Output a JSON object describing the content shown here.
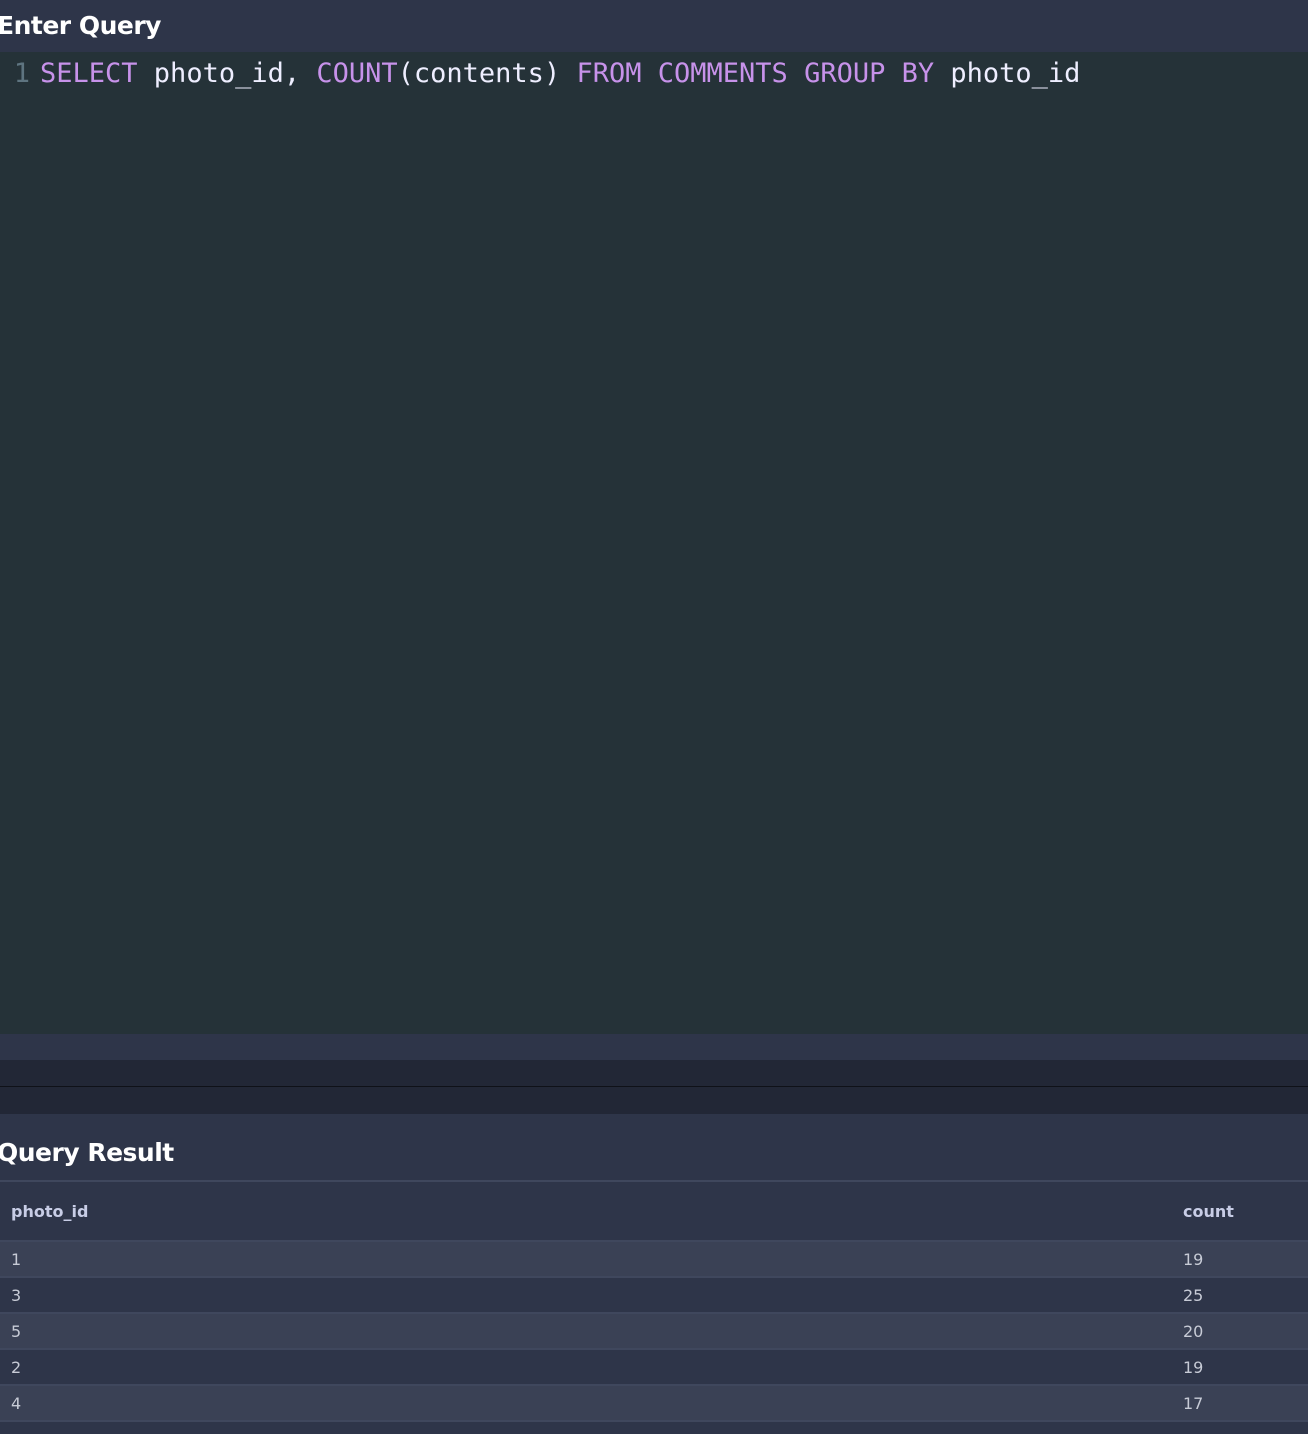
{
  "editor": {
    "title": "Enter Query",
    "line_number": "1",
    "tokens": [
      {
        "t": "SELECT",
        "k": "kw"
      },
      {
        "t": " photo_id, ",
        "k": "id"
      },
      {
        "t": "COUNT",
        "k": "kw"
      },
      {
        "t": "(contents) ",
        "k": "id"
      },
      {
        "t": "FROM",
        "k": "kw"
      },
      {
        "t": " ",
        "k": "id"
      },
      {
        "t": "COMMENTS",
        "k": "kw"
      },
      {
        "t": " ",
        "k": "id"
      },
      {
        "t": "GROUP",
        "k": "kw"
      },
      {
        "t": " ",
        "k": "id"
      },
      {
        "t": "BY",
        "k": "kw"
      },
      {
        "t": " photo_id",
        "k": "id"
      }
    ]
  },
  "result": {
    "title": "Query Result",
    "columns": [
      "photo_id",
      "count"
    ],
    "rows": [
      [
        "1",
        "19"
      ],
      [
        "3",
        "25"
      ],
      [
        "5",
        "20"
      ],
      [
        "2",
        "19"
      ],
      [
        "4",
        "17"
      ]
    ]
  },
  "colors": {
    "keyword": "#c792ea",
    "editor_bg": "#253238",
    "panel_bg": "#2e3549"
  }
}
